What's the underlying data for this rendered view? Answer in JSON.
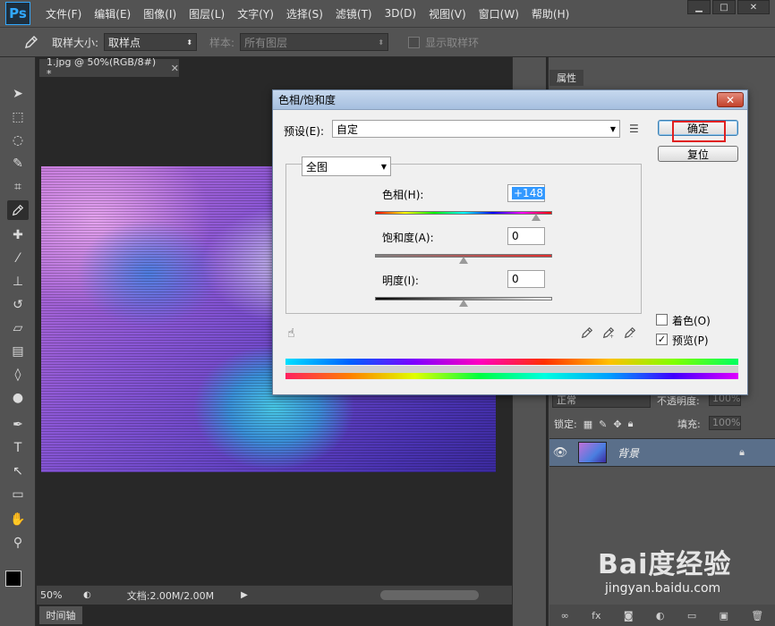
{
  "app": {
    "logo": "Ps"
  },
  "menu": [
    "文件(F)",
    "编辑(E)",
    "图像(I)",
    "图层(L)",
    "文字(Y)",
    "选择(S)",
    "滤镜(T)",
    "3D(D)",
    "视图(V)",
    "窗口(W)",
    "帮助(H)"
  ],
  "options": {
    "sample_size_label": "取样大小:",
    "sample_size_value": "取样点",
    "sample_label": "样本:",
    "sample_value": "所有图层",
    "show_ring_label": "显示取样环"
  },
  "document": {
    "tab_title": "1.jpg @ 50%(RGB/8#) *",
    "zoom": "50%",
    "doc_info": "文档:2.00M/2.00M"
  },
  "timeline": {
    "label": "时间轴"
  },
  "panels": {
    "properties_tab": "属性",
    "blend_mode": "正常",
    "opacity_label": "不透明度:",
    "opacity_value": "100%",
    "lock_label": "锁定:",
    "fill_label": "填充:",
    "fill_value": "100%",
    "layer_name": "背景"
  },
  "dialog": {
    "title": "色相/饱和度",
    "preset_label": "预设(E):",
    "preset_value": "自定",
    "ok_label": "确定",
    "reset_label": "复位",
    "channel_value": "全图",
    "hue_label": "色相(H):",
    "hue_value": "+148",
    "hue_fraction": 0.91,
    "saturation_label": "饱和度(A):",
    "saturation_value": "0",
    "saturation_fraction": 0.5,
    "lightness_label": "明度(I):",
    "lightness_value": "0",
    "lightness_fraction": 0.5,
    "colorize_label": "着色(O)",
    "colorize_checked": false,
    "preview_label": "预览(P)",
    "preview_checked": true
  },
  "watermark": {
    "brand": "Bai度经验",
    "url": "jingyan.baidu.com"
  }
}
